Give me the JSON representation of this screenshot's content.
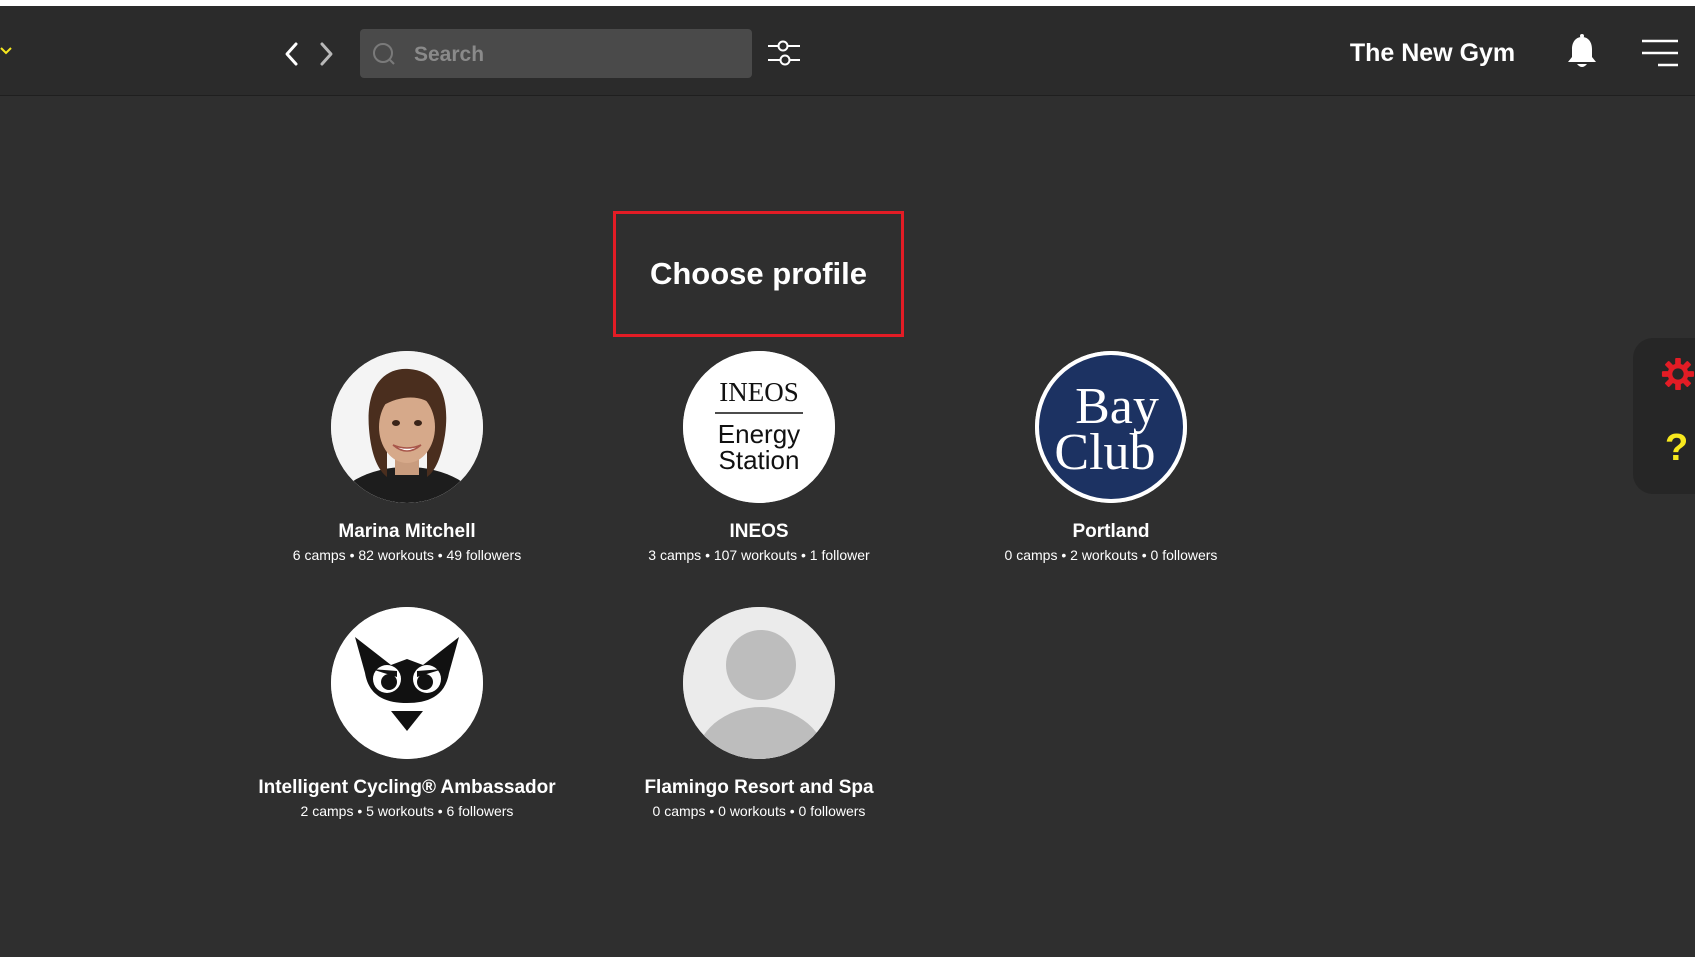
{
  "header": {
    "search_placeholder": "Search",
    "gym_name": "The New Gym"
  },
  "page": {
    "title": "Choose profile"
  },
  "profiles": [
    {
      "name": "Marina Mitchell",
      "stats": "6 camps • 82 workouts • 49 followers"
    },
    {
      "name": "INEOS",
      "stats": "3 camps • 107 workouts • 1 follower",
      "logo_text": [
        "INEOS",
        "Energy",
        "Station"
      ]
    },
    {
      "name": "Portland",
      "stats": "0 camps • 2 workouts • 0 followers",
      "logo_text": [
        "Bay",
        "Club"
      ]
    },
    {
      "name": "Intelligent Cycling® Ambassador",
      "stats": "2 camps • 5 workouts • 6 followers"
    },
    {
      "name": "Flamingo Resort and Spa",
      "stats": "0 camps • 0 workouts • 0 followers"
    }
  ],
  "side_panel": {
    "help_symbol": "?"
  },
  "colors": {
    "background": "#2f2f2f",
    "header": "#2b2b2b",
    "accent_yellow": "#f7e81e",
    "highlight_red": "#e31c25",
    "gear_red": "#e31c25",
    "bayclub_navy": "#1c3262"
  },
  "icons": {
    "back": "chevron-left-icon",
    "forward": "chevron-right-icon",
    "search": "search-icon",
    "filter": "sliders-icon",
    "notifications": "bell-icon",
    "menu": "hamburger-menu-icon",
    "settings": "gear-icon",
    "help": "question-icon"
  }
}
